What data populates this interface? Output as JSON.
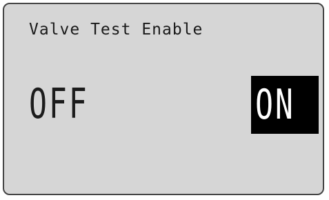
{
  "screen": {
    "title": "Valve Test Enable",
    "options": [
      {
        "label": "OFF",
        "selected": false
      },
      {
        "label": "ON",
        "selected": true
      }
    ]
  },
  "colors": {
    "lcd_background": "#d6d6d6",
    "highlight_background": "#000000",
    "highlight_text": "#ffffff",
    "text": "#111111"
  }
}
